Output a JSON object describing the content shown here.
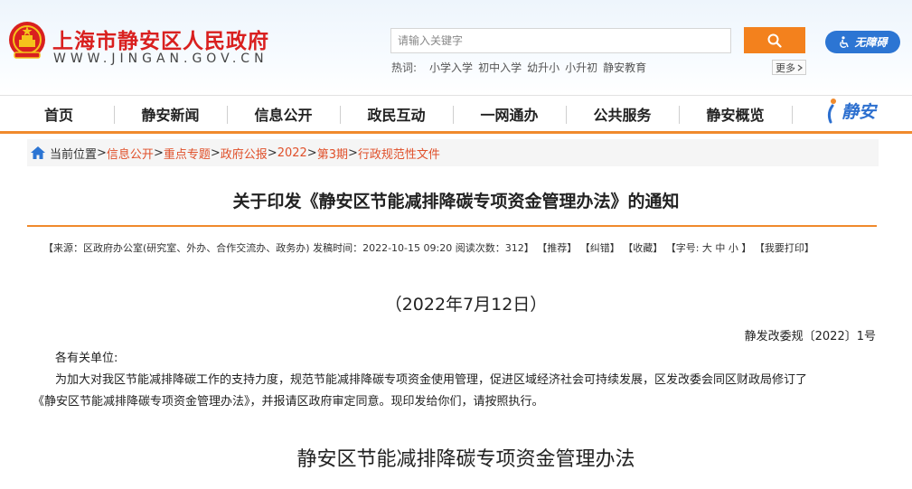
{
  "header": {
    "title": "上海市静安区人民政府",
    "url": "WWW.JINGAN.GOV.CN",
    "search": {
      "placeholder": "请输入关键字"
    },
    "hot": {
      "label": "热词:",
      "links": [
        "小学入学",
        "初中入学",
        "幼升小",
        "小升初",
        "静安教育"
      ]
    },
    "more_label": "更多",
    "accessibility_label": "无障碍"
  },
  "nav": {
    "items": [
      "首页",
      "静安新闻",
      "信息公开",
      "政民互动",
      "一网通办",
      "公共服务",
      "静安概览"
    ],
    "logo_text": "静安"
  },
  "breadcrumb": {
    "label": "当前位置",
    "links": [
      "信息公开",
      "重点专题",
      "政府公报",
      "2022",
      "第3期",
      "行政规范性文件"
    ]
  },
  "article": {
    "title": "关于印发《静安区节能减排降碳专项资金管理办法》的通知",
    "meta": {
      "source": "【来源：区政府办公室(研究室、外办、合作交流办、政务办) 发稿时间：2022-10-15 09:20 阅读次数：312】",
      "recommend": "【推荐】",
      "correct": "【纠错】",
      "favorite": "【收藏】",
      "font_label": "【字号:",
      "font_large": "大",
      "font_medium": "中",
      "font_small": "小",
      "font_end": "】",
      "print": "【我要打印】"
    },
    "date": "（2022年7月12日）",
    "doc_number": "静发改委规〔2022〕1号",
    "salutation": "各有关单位:",
    "body_line1": "为加大对我区节能减排降碳工作的支持力度，规范节能减排降碳专项资金使用管理，促进区域经济社会可持续发展，区发改委会同区财政局修订了",
    "body_line2": "《静安区节能减排降碳专项资金管理办法》，并报请区政府审定同意。现印发给你们，请按照执行。",
    "subtitle": "静安区节能减排降碳专项资金管理办法"
  },
  "colors": {
    "brand_red": "#d9201f",
    "accent_orange": "#f08a2c",
    "link_orange": "#e0502a",
    "blue": "#2c75d3"
  }
}
